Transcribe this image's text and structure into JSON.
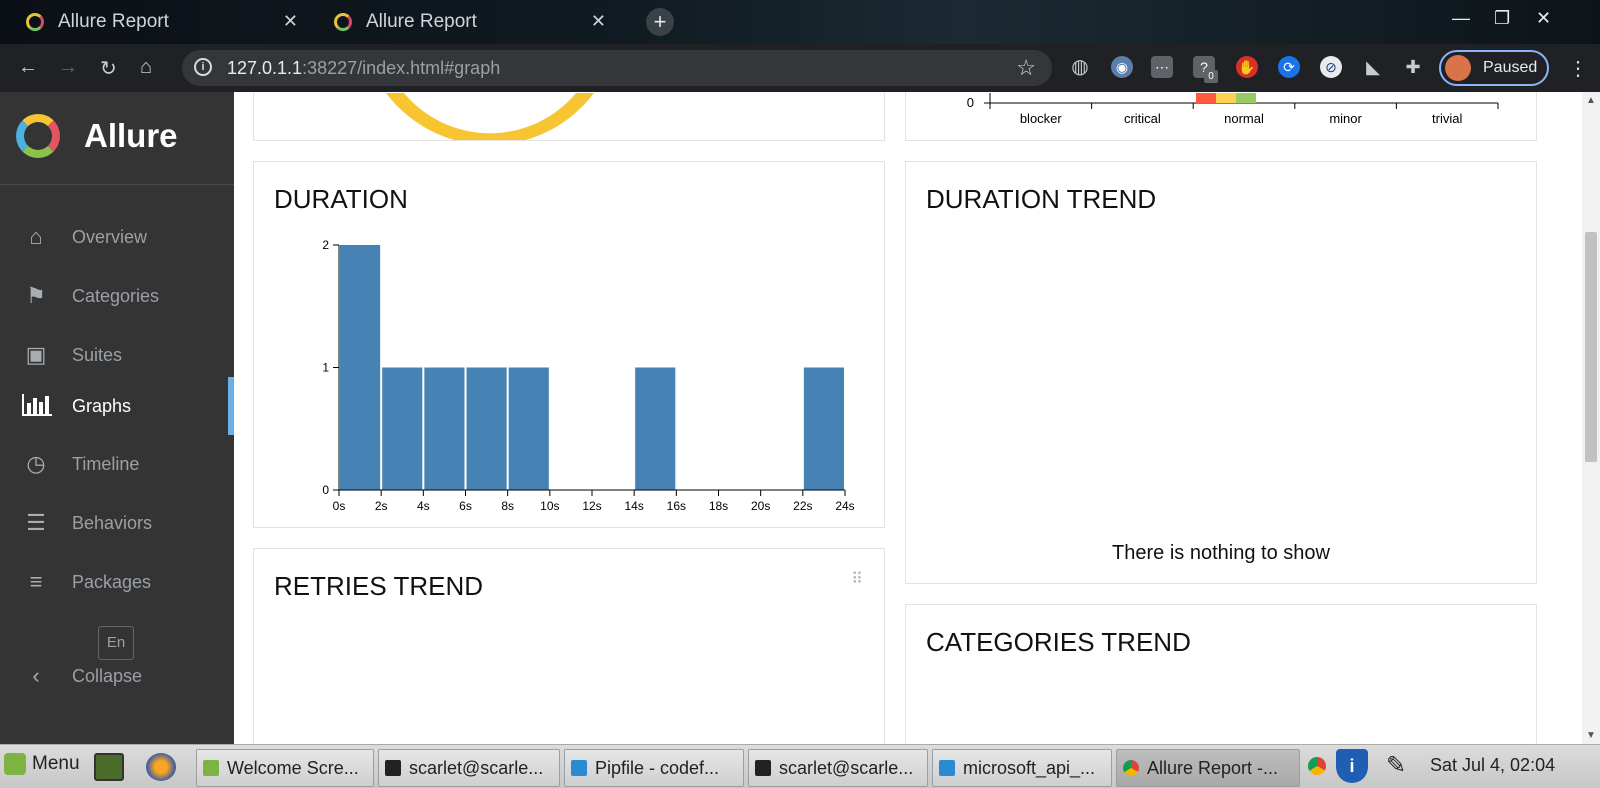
{
  "browser": {
    "tabs": [
      {
        "title": "Allure Report"
      },
      {
        "title": "Allure Report"
      }
    ],
    "url_host": "127.0.1.1",
    "url_rest": ":38227/index.html#graph",
    "profile_label": "Paused",
    "extension_badge": "0"
  },
  "sidebar": {
    "brand": "Allure",
    "items": [
      {
        "label": "Overview",
        "icon": "home-icon"
      },
      {
        "label": "Categories",
        "icon": "flag-icon"
      },
      {
        "label": "Suites",
        "icon": "briefcase-icon"
      },
      {
        "label": "Graphs",
        "icon": "bar-chart-icon",
        "active": true
      },
      {
        "label": "Timeline",
        "icon": "clock-icon"
      },
      {
        "label": "Behaviors",
        "icon": "list-icon"
      },
      {
        "label": "Packages",
        "icon": "align-left-icon"
      }
    ],
    "language": "En",
    "collapse_label": "Collapse"
  },
  "severity_chart": {
    "chart_data": {
      "type": "bar",
      "categories": [
        "blocker",
        "critical",
        "normal",
        "minor",
        "trivial"
      ],
      "y_tick_visible": "0"
    }
  },
  "duration": {
    "title": "DURATION",
    "chart_data": {
      "type": "bar",
      "x_ticks": [
        "0s",
        "2s",
        "4s",
        "6s",
        "8s",
        "10s",
        "12s",
        "14s",
        "16s",
        "18s",
        "20s",
        "22s",
        "24s"
      ],
      "y_ticks": [
        "0",
        "1",
        "2"
      ],
      "ylim": [
        0,
        2
      ],
      "xlim": [
        0,
        24
      ],
      "bins": [
        {
          "from": 0,
          "to": 2,
          "count": 2
        },
        {
          "from": 2,
          "to": 4,
          "count": 1
        },
        {
          "from": 4,
          "to": 6,
          "count": 1
        },
        {
          "from": 6,
          "to": 8,
          "count": 1
        },
        {
          "from": 8,
          "to": 10,
          "count": 1
        },
        {
          "from": 14,
          "to": 16,
          "count": 1
        },
        {
          "from": 22,
          "to": 24,
          "count": 1
        }
      ],
      "bar_color": "#4682b4"
    }
  },
  "duration_trend": {
    "title": "DURATION TREND",
    "empty_message": "There is nothing to show"
  },
  "retries_trend": {
    "title": "RETRIES TREND"
  },
  "categories_trend": {
    "title": "CATEGORIES TREND"
  },
  "taskbar": {
    "menu_label": "Menu",
    "tasks": [
      {
        "label": "Welcome Scre..."
      },
      {
        "label": "scarlet@scarle..."
      },
      {
        "label": "Pipfile - codef..."
      },
      {
        "label": "scarlet@scarle..."
      },
      {
        "label": "microsoft_api_..."
      },
      {
        "label": "Allure Report -..."
      }
    ],
    "clock": "Sat Jul  4, 02:04"
  }
}
